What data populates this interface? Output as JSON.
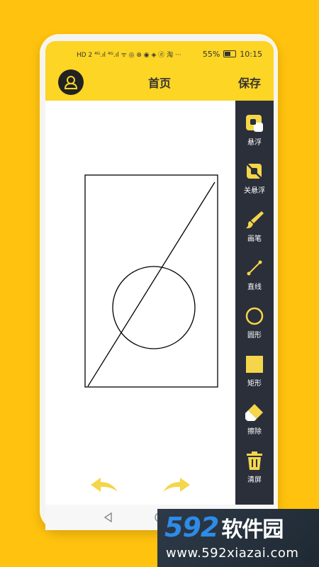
{
  "status_bar": {
    "left_icons": "HD 2 ⁴ᴳ.ıl ⁴ᴳ.ıl ᯤ ◎ ⊗ ◉ ◈ ⓓ 淘 ···",
    "battery": "55%",
    "time": "10:15"
  },
  "appbar": {
    "title": "首页",
    "save_label": "保存"
  },
  "toolbar": {
    "items": [
      {
        "label": "悬浮",
        "icon": "float-window-icon"
      },
      {
        "label": "关悬浮",
        "icon": "float-off-icon"
      },
      {
        "label": "画笔",
        "icon": "brush-icon"
      },
      {
        "label": "直线",
        "icon": "line-icon"
      },
      {
        "label": "圆形",
        "icon": "circle-icon"
      },
      {
        "label": "矩形",
        "icon": "rectangle-icon"
      },
      {
        "label": "擦除",
        "icon": "eraser-icon"
      },
      {
        "label": "清屏",
        "icon": "trash-icon"
      }
    ]
  },
  "colors": {
    "background": "#FFC20E",
    "bar": "#FCD525",
    "toolbar": "#2A2F3A",
    "accent": "#F5D64A"
  },
  "watermark": {
    "brand_num": "592",
    "brand_cn": "软件园",
    "url": "www.592xiazai.com"
  }
}
